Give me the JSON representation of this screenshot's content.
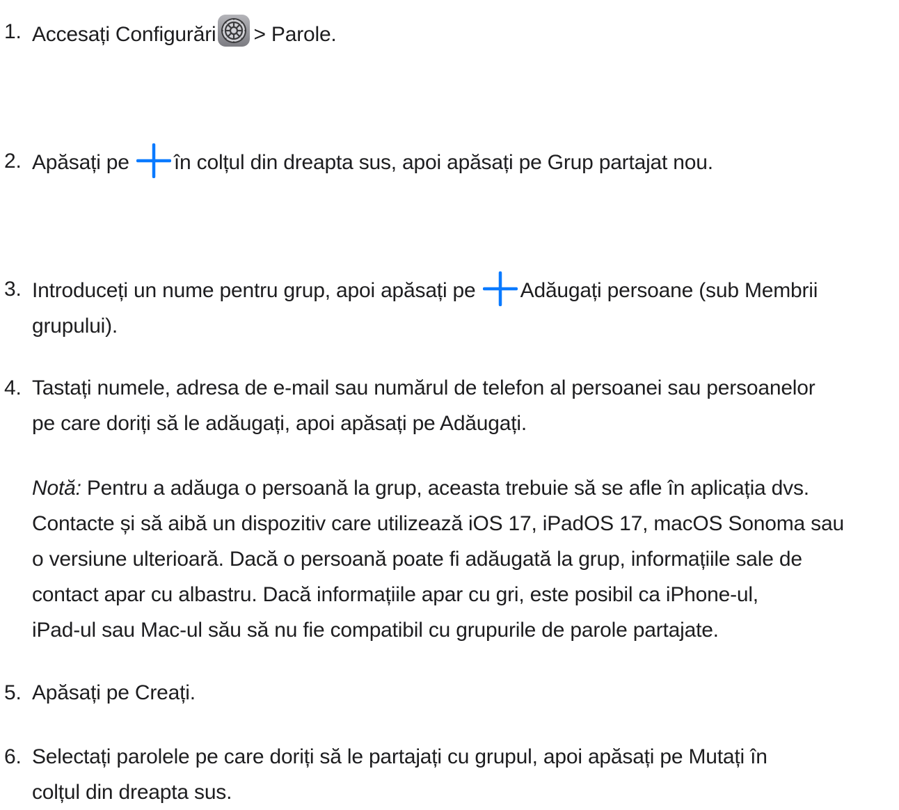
{
  "steps": [
    {
      "number": "1.",
      "before": "Accesați Configurări",
      "icon": "settings-gear-icon",
      "after": "> Parole."
    },
    {
      "number": "2.",
      "before": "Apăsați pe",
      "icon": "plus-icon",
      "after": "în colțul din dreapta sus, apoi apăsați pe Grup partajat nou."
    },
    {
      "number": "3.",
      "before": "Introduceți un nume pentru grup, apoi apăsați pe",
      "icon": "plus-icon",
      "after_line1": "Adăugați persoane (sub Membrii",
      "after_line2": "grupului)."
    },
    {
      "number": "4.",
      "text_line1": "Tastați numele, adresa de e-mail sau numărul de telefon al persoanei sau persoanelor",
      "text_line2": "pe care doriți să le adăugați, apoi apăsați pe Adăugați.",
      "note": {
        "label": "Notă:",
        "line1": "Pentru a adăuga o persoană la grup, aceasta trebuie să se afle în aplicația dvs.",
        "line2": "Contacte și să aibă un dispozitiv care utilizează iOS 17, iPadOS 17, macOS Sonoma sau",
        "line3": "o versiune ulterioară. Dacă o persoană poate fi adăugată la grup, informațiile sale de",
        "line4": "contact apar cu albastru. Dacă informațiile apar cu gri, este posibil ca iPhone-ul,",
        "line5": "iPad-ul sau Mac-ul său să nu fie compatibil cu grupurile de parole partajate."
      }
    },
    {
      "number": "5.",
      "text": "Apăsați pe Creați."
    },
    {
      "number": "6.",
      "text_line1": "Selectați parolele pe care doriți să le partajați cu grupul, apoi apăsați pe Mutați în",
      "text_line2": "colțul din dreapta sus."
    }
  ],
  "colors": {
    "text": "#1d1d1f",
    "accent": "#0a7aff",
    "settings_icon_bg": "#8e8e93"
  }
}
